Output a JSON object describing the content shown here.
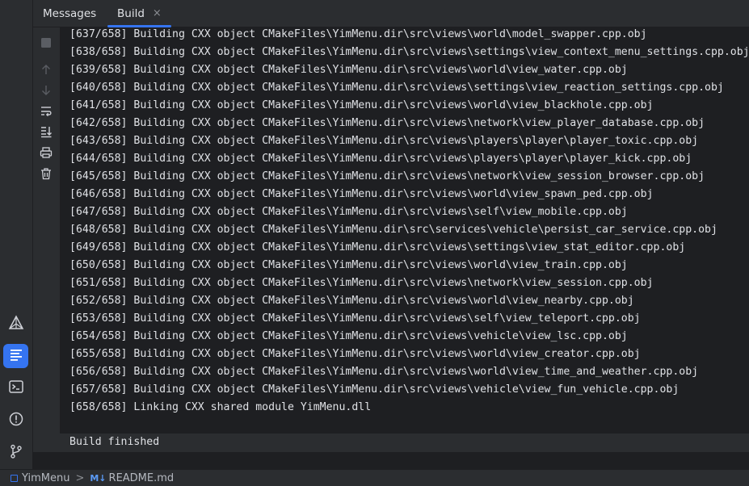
{
  "tabs": [
    {
      "label": "Messages"
    },
    {
      "label": "Build",
      "close": "×"
    }
  ],
  "toolbar_icons": [
    "stop-icon",
    "up-arrow-icon",
    "down-arrow-icon",
    "soft-wrap-icon",
    "scroll-to-end-icon",
    "print-icon",
    "trash-icon"
  ],
  "left_strip_icons": [
    "cmake-icon",
    "build-icon",
    "terminal-icon",
    "problems-icon",
    "git-icon"
  ],
  "log_lines": [
    "[637/658] Building CXX object CMakeFiles\\YimMenu.dir\\src\\views\\world\\model_swapper.cpp.obj",
    "[638/658] Building CXX object CMakeFiles\\YimMenu.dir\\src\\views\\settings\\view_context_menu_settings.cpp.obj",
    "[639/658] Building CXX object CMakeFiles\\YimMenu.dir\\src\\views\\world\\view_water.cpp.obj",
    "[640/658] Building CXX object CMakeFiles\\YimMenu.dir\\src\\views\\settings\\view_reaction_settings.cpp.obj",
    "[641/658] Building CXX object CMakeFiles\\YimMenu.dir\\src\\views\\world\\view_blackhole.cpp.obj",
    "[642/658] Building CXX object CMakeFiles\\YimMenu.dir\\src\\views\\network\\view_player_database.cpp.obj",
    "[643/658] Building CXX object CMakeFiles\\YimMenu.dir\\src\\views\\players\\player\\player_toxic.cpp.obj",
    "[644/658] Building CXX object CMakeFiles\\YimMenu.dir\\src\\views\\players\\player\\player_kick.cpp.obj",
    "[645/658] Building CXX object CMakeFiles\\YimMenu.dir\\src\\views\\network\\view_session_browser.cpp.obj",
    "[646/658] Building CXX object CMakeFiles\\YimMenu.dir\\src\\views\\world\\view_spawn_ped.cpp.obj",
    "[647/658] Building CXX object CMakeFiles\\YimMenu.dir\\src\\views\\self\\view_mobile.cpp.obj",
    "[648/658] Building CXX object CMakeFiles\\YimMenu.dir\\src\\services\\vehicle\\persist_car_service.cpp.obj",
    "[649/658] Building CXX object CMakeFiles\\YimMenu.dir\\src\\views\\settings\\view_stat_editor.cpp.obj",
    "[650/658] Building CXX object CMakeFiles\\YimMenu.dir\\src\\views\\world\\view_train.cpp.obj",
    "[651/658] Building CXX object CMakeFiles\\YimMenu.dir\\src\\views\\network\\view_session.cpp.obj",
    "[652/658] Building CXX object CMakeFiles\\YimMenu.dir\\src\\views\\world\\view_nearby.cpp.obj",
    "[653/658] Building CXX object CMakeFiles\\YimMenu.dir\\src\\views\\self\\view_teleport.cpp.obj",
    "[654/658] Building CXX object CMakeFiles\\YimMenu.dir\\src\\views\\vehicle\\view_lsc.cpp.obj",
    "[655/658] Building CXX object CMakeFiles\\YimMenu.dir\\src\\views\\world\\view_creator.cpp.obj",
    "[656/658] Building CXX object CMakeFiles\\YimMenu.dir\\src\\views\\world\\view_time_and_weather.cpp.obj",
    "[657/658] Building CXX object CMakeFiles\\YimMenu.dir\\src\\views\\vehicle\\view_fun_vehicle.cpp.obj",
    "[658/658] Linking CXX shared module YimMenu.dll"
  ],
  "status_message": "Build finished",
  "breadcrumb": {
    "project": "YimMenu",
    "separator": ">",
    "file_badge": "M↓",
    "file": "README.md"
  },
  "colors": {
    "accent": "#3574f0",
    "panel": "#2b2d30",
    "background": "#1e1f22",
    "text": "#dfe1e5"
  }
}
